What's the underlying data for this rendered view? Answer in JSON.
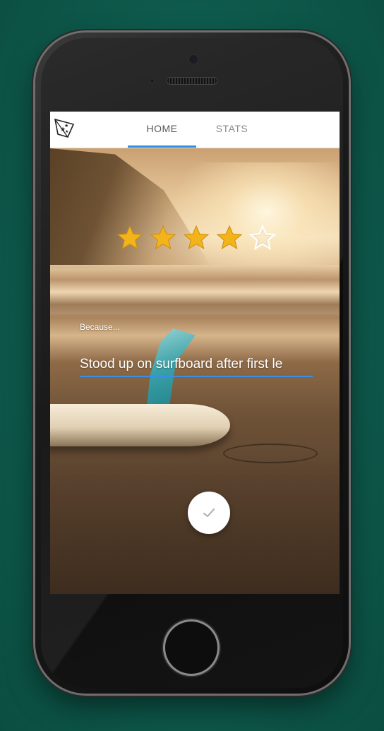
{
  "tabs": [
    {
      "label": "HOME",
      "active": true
    },
    {
      "label": "STATS",
      "active": false
    }
  ],
  "rating": {
    "value": 4,
    "max": 5,
    "filled_color": "#f2b31b",
    "empty_color": "#ffffff"
  },
  "reason": {
    "label": "Because...",
    "value": "Stood up on surfboard after first le"
  },
  "submit": {
    "icon": "check-icon"
  },
  "colors": {
    "accent": "#2f8de4",
    "background": "#0d5a4d"
  }
}
